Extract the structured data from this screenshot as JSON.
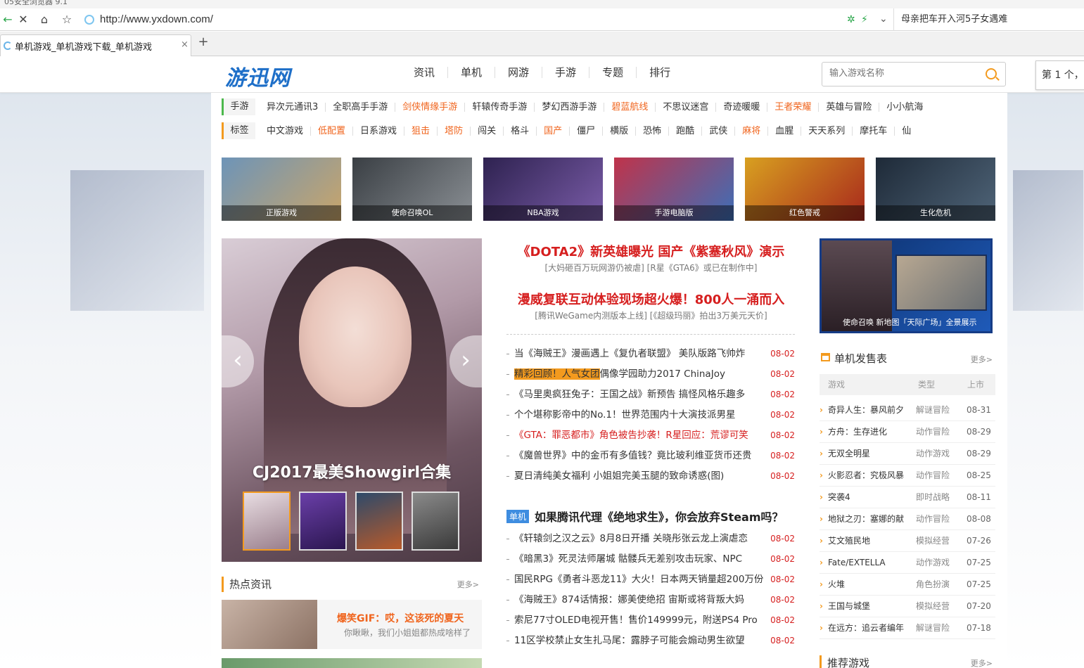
{
  "browser": {
    "window_title": "05安全浏览器 9.1",
    "url": "http://www.yxdown.com/",
    "search_hint": "母亲把车开入河5子女遇难",
    "tab_title": "单机游戏_单机游戏下载_单机游戏",
    "tab_close": "×",
    "new_tab": "+",
    "back": "←",
    "stop": "✕",
    "home": "⌂",
    "star": "☆"
  },
  "site": {
    "logo": "游迅网",
    "nav": [
      "资讯",
      "单机",
      "网游",
      "手游",
      "专题",
      "排行"
    ],
    "search_placeholder": "输入游戏名称",
    "page_counter": "第 1 个，",
    "mobile_tags": {
      "label": "手游",
      "items": [
        {
          "text": "异次元通讯3",
          "hot": false
        },
        {
          "text": "全职高手手游",
          "hot": false
        },
        {
          "text": "剑侠情缘手游",
          "hot": true
        },
        {
          "text": "轩辕传奇手游",
          "hot": false
        },
        {
          "text": "梦幻西游手游",
          "hot": false
        },
        {
          "text": "碧蓝航线",
          "hot": true
        },
        {
          "text": "不思议迷宫",
          "hot": false
        },
        {
          "text": "奇迹暖暖",
          "hot": false
        },
        {
          "text": "王者荣耀",
          "hot": true
        },
        {
          "text": "英雄与冒险",
          "hot": false
        },
        {
          "text": "小小航海",
          "hot": false
        }
      ]
    },
    "label_tags": {
      "label": "标签",
      "items": [
        {
          "text": "中文游戏",
          "hot": false
        },
        {
          "text": "低配置",
          "hot": true
        },
        {
          "text": "日系游戏",
          "hot": false
        },
        {
          "text": "狙击",
          "hot": true
        },
        {
          "text": "塔防",
          "hot": true
        },
        {
          "text": "闯关",
          "hot": false
        },
        {
          "text": "格斗",
          "hot": false
        },
        {
          "text": "国产",
          "hot": true
        },
        {
          "text": "僵尸",
          "hot": false
        },
        {
          "text": "横版",
          "hot": false
        },
        {
          "text": "恐怖",
          "hot": false
        },
        {
          "text": "跑酷",
          "hot": false
        },
        {
          "text": "武侠",
          "hot": false
        },
        {
          "text": "麻将",
          "hot": true
        },
        {
          "text": "血腥",
          "hot": false
        },
        {
          "text": "天天系列",
          "hot": false
        },
        {
          "text": "摩托车",
          "hot": false
        },
        {
          "text": "仙",
          "hot": false
        }
      ]
    },
    "thumbs": [
      {
        "caption": "正版游戏",
        "color1": "#6d94b8",
        "color2": "#c9a56a"
      },
      {
        "caption": "使命召唤OL",
        "color1": "#3a3f44",
        "color2": "#8a8f94"
      },
      {
        "caption": "NBA游戏",
        "color1": "#2e2250",
        "color2": "#7a5ca8"
      },
      {
        "caption": "手游电脑版",
        "color1": "#c0334a",
        "color2": "#3d6fb8"
      },
      {
        "caption": "红色警戒",
        "color1": "#d8a020",
        "color2": "#a8281c"
      },
      {
        "caption": "生化危机",
        "color1": "#1e2a38",
        "color2": "#4f6478"
      }
    ],
    "carousel": {
      "caption": "CJ2017最美Showgirl合集",
      "prev": "‹",
      "next": "›"
    },
    "hot_news": {
      "title": "热点资讯",
      "more": "更多>",
      "item_title": "爆笑GIF：哎，这该死的夏天",
      "item_sub": "你瞅瞅，我们小姐姐都热成啥样了"
    },
    "headlines": [
      {
        "title": "《DOTA2》新英雄曝光  国产《紫塞秋风》演示",
        "sub": "[大妈砸百万玩网游仍被虐] [R星《GTA6》或已在制作中]"
      },
      {
        "title": "漫威复联互动体验现场超火爆！800人一涌而入",
        "sub": "[腾讯WeGame内测版本上线] [《超级玛丽》拍出3万美元天价]"
      }
    ],
    "news_list1": [
      {
        "badge": "",
        "text": "当《海贼王》漫画遇上《复仇者联盟》 美队版路飞帅炸",
        "date": "08-02",
        "red": false
      },
      {
        "badge": "精彩回顾！人气女团",
        "text": "偶像学园助力2017 ChinaJoy",
        "date": "08-02",
        "red": false
      },
      {
        "badge": "",
        "text": "《马里奥疯狂兔子：王国之战》新预告 搞怪风格乐趣多",
        "date": "08-02",
        "red": false
      },
      {
        "badge": "",
        "text": "个个堪称影帝中的No.1！世界范围内十大演技派男星",
        "date": "08-02",
        "red": false
      },
      {
        "badge": "",
        "text": "《GTA：罪恶都市》角色被告抄袭！R星回应：荒谬可笑",
        "date": "08-02",
        "red": true
      },
      {
        "badge": "",
        "text": "《魔兽世界》中的金币有多值钱？竟比玻利维亚货币还贵",
        "date": "08-02",
        "red": false
      },
      {
        "badge": "",
        "text": "夏日清纯美女福利 小姐姐完美玉腿的致命诱惑(图)",
        "date": "08-02",
        "red": false
      }
    ],
    "section2": {
      "badge": "单机",
      "title": "如果腾讯代理《绝地求生》，你会放弃Steam吗？"
    },
    "news_list2": [
      {
        "text": "《轩辕剑之汉之云》8月8日开播 关晓彤张云龙上演虐恋",
        "date": "08-02"
      },
      {
        "text": "《暗黑3》死灵法师屠城 骷髅兵无差别攻击玩家、NPC",
        "date": "08-02"
      },
      {
        "text": "国民RPG《勇者斗恶龙11》大火！日本两天销量超200万份",
        "date": "08-02"
      },
      {
        "text": "《海贼王》874话情报：娜美使绝招 宙斯或将背叛大妈",
        "date": "08-02"
      },
      {
        "text": "索尼77寸OLED电视开售！售价149999元，附送PS4 Pro",
        "date": "08-02"
      },
      {
        "text": "11区学校禁止女生扎马尾：露脖子可能会煽动男生欲望",
        "date": "08-02"
      }
    ],
    "promo_text": "使命召唤 新地图「天际广场」全景展示",
    "release": {
      "title": "单机发售表",
      "more": "更多>",
      "col_game": "游戏",
      "col_type": "类型",
      "col_date": "上市",
      "rows": [
        {
          "game": "奇异人生：暴风前夕",
          "type": "解谜冒险",
          "date": "08-31"
        },
        {
          "game": "方舟：生存进化",
          "type": "动作冒险",
          "date": "08-29"
        },
        {
          "game": "无双全明星",
          "type": "动作游戏",
          "date": "08-29"
        },
        {
          "game": "火影忍者：究极风暴",
          "type": "动作冒险",
          "date": "08-25"
        },
        {
          "game": "突袭4",
          "type": "即时战略",
          "date": "08-11"
        },
        {
          "game": "地狱之刃：塞娜的献",
          "type": "动作冒险",
          "date": "08-08"
        },
        {
          "game": "艾文殖民地",
          "type": "模拟经营",
          "date": "07-26"
        },
        {
          "game": "Fate/EXTELLA",
          "type": "动作游戏",
          "date": "07-25"
        },
        {
          "game": "火堆",
          "type": "角色扮演",
          "date": "07-25"
        },
        {
          "game": "王国与城堡",
          "type": "模拟经营",
          "date": "07-20"
        },
        {
          "game": "在远方：追云者编年",
          "type": "解谜冒险",
          "date": "07-18"
        }
      ]
    },
    "recommend": {
      "title": "推荐游戏",
      "more": "更多>"
    }
  }
}
